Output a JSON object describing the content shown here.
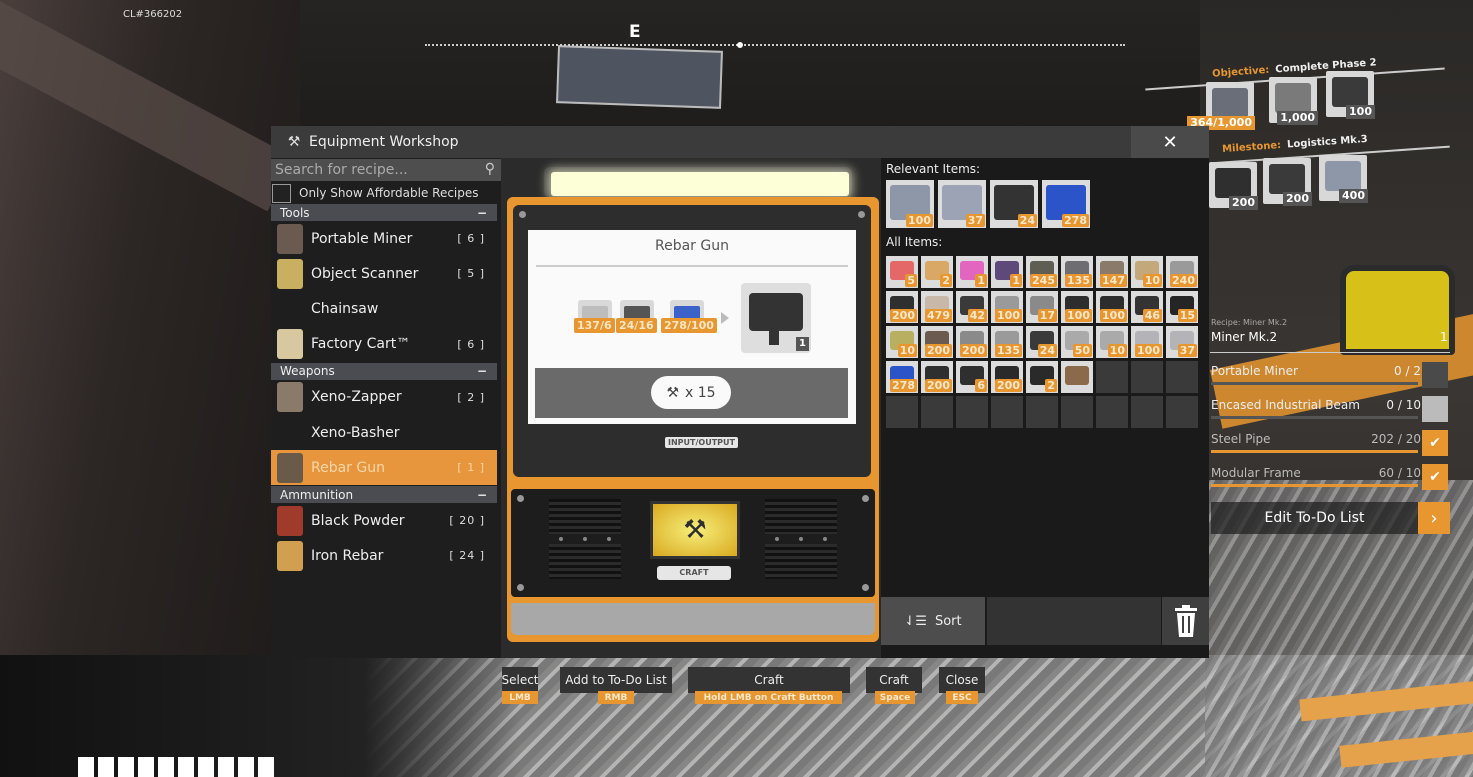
{
  "hud": {
    "build_id": "CL#366202",
    "compass_heading": "E",
    "hotbar_slots": 10
  },
  "window": {
    "title": "Equipment Workshop",
    "title_icon": "hammer-icon",
    "close_icon": "close-icon"
  },
  "recipes": {
    "search_placeholder": "Search for recipe...",
    "affordable_label": "Only Show Affordable Recipes",
    "affordable_checked": false,
    "categories": [
      {
        "name": "Tools",
        "toggle": "−",
        "items": [
          {
            "name": "Portable Miner",
            "count": "[ 6 ]"
          },
          {
            "name": "Object Scanner",
            "count": "[ 5 ]"
          },
          {
            "name": "Chainsaw",
            "count": ""
          },
          {
            "name": "Factory Cart™",
            "count": "[ 6 ]"
          }
        ]
      },
      {
        "name": "Weapons",
        "toggle": "−",
        "items": [
          {
            "name": "Xeno-Zapper",
            "count": "[ 2 ]"
          },
          {
            "name": "Xeno-Basher",
            "count": ""
          },
          {
            "name": "Rebar Gun",
            "count": "[ 1 ]",
            "selected": true
          }
        ]
      },
      {
        "name": "Ammunition",
        "toggle": "−",
        "items": [
          {
            "name": "Black Powder",
            "count": "[ 20 ]"
          },
          {
            "name": "Iron Rebar",
            "count": "[ 24 ]"
          }
        ]
      }
    ]
  },
  "craft": {
    "recipe_name": "Rebar Gun",
    "ingredients": [
      {
        "icon": "reinforced-plate-icon",
        "have_need": "137/6"
      },
      {
        "icon": "iron-rod-icon",
        "have_need": "24/16"
      },
      {
        "icon": "screw-icon",
        "have_need": "278/100"
      }
    ],
    "product": {
      "name": "Rebar Gun",
      "quantity": "1"
    },
    "craft_clicks": "x 15",
    "io_label": "INPUT/OUTPUT",
    "craft_button_label": "CRAFT"
  },
  "inventory": {
    "relevant_label": "Relevant Items:",
    "relevant_items": [
      {
        "icon": "iron-plate-icon",
        "qty": "100",
        "color": "#8e97a8"
      },
      {
        "icon": "reinforced-plate-icon",
        "qty": "37",
        "color": "#9ba3b5"
      },
      {
        "icon": "iron-rod-icon",
        "qty": "24",
        "color": "#333333"
      },
      {
        "icon": "screw-box-icon",
        "qty": "278",
        "color": "#2b54c9"
      }
    ],
    "all_label": "All Items:",
    "all_items": [
      {
        "qty": "5",
        "color": "#e46868"
      },
      {
        "qty": "2",
        "color": "#d9a867"
      },
      {
        "qty": "1",
        "color": "#e266c0"
      },
      {
        "qty": "1",
        "color": "#5e4a7a"
      },
      {
        "qty": "245",
        "color": "#5e5e52"
      },
      {
        "qty": "135",
        "color": "#6e6e72"
      },
      {
        "qty": "147",
        "color": "#8a7a6a"
      },
      {
        "qty": "10",
        "color": "#c2a87a"
      },
      {
        "qty": "240",
        "color": "#9a9a9a"
      },
      {
        "qty": "200",
        "color": "#2f2f2f"
      },
      {
        "qty": "479",
        "color": "#c8b8a8"
      },
      {
        "qty": "42",
        "color": "#3a3a3a"
      },
      {
        "qty": "100",
        "color": "#9a9a9a"
      },
      {
        "qty": "17",
        "color": "#8a8a8a"
      },
      {
        "qty": "100",
        "color": "#2d2d2d"
      },
      {
        "qty": "100",
        "color": "#2d2d2d"
      },
      {
        "qty": "46",
        "color": "#333333"
      },
      {
        "qty": "15",
        "color": "#252525"
      },
      {
        "qty": "10",
        "color": "#b8b060"
      },
      {
        "qty": "200",
        "color": "#6a5a50"
      },
      {
        "qty": "200",
        "color": "#8a8a8a"
      },
      {
        "qty": "135",
        "color": "#9a9a9a"
      },
      {
        "qty": "24",
        "color": "#3a3a3a"
      },
      {
        "qty": "50",
        "color": "#aaaaaa"
      },
      {
        "qty": "10",
        "color": "#aaaaaa"
      },
      {
        "qty": "100",
        "color": "#b4b4b8"
      },
      {
        "qty": "37",
        "color": "#b4b4b8"
      },
      {
        "qty": "278",
        "color": "#2b54c9"
      },
      {
        "qty": "200",
        "color": "#2f2f2f"
      },
      {
        "qty": "6",
        "color": "#2f2f2f"
      },
      {
        "qty": "200",
        "color": "#2a2a2a"
      },
      {
        "qty": "2",
        "color": "#2a2a2a"
      },
      {
        "qty": "",
        "color": "#8a6a4a"
      }
    ],
    "total_slots": 45,
    "sort_label": "Sort",
    "trash_icon": "trash-icon"
  },
  "key_hints": [
    {
      "action": "Select",
      "key": "LMB"
    },
    {
      "action": "Add to To-Do List",
      "key": "RMB"
    },
    {
      "action": "Craft",
      "key": "Hold LMB on Craft Button"
    },
    {
      "action": "Craft",
      "key": "Space"
    },
    {
      "action": "Close",
      "key": "ESC"
    }
  ],
  "objective": {
    "label": "Objective:",
    "value": "Complete Phase 2",
    "items": [
      {
        "qty": "364/1,000",
        "color": "#6a6e78"
      },
      {
        "qty": "1,000",
        "color": "#7a7a7a"
      },
      {
        "qty": "100",
        "color": "#3a3a3a"
      }
    ]
  },
  "milestone": {
    "label": "Milestone:",
    "value": "Logistics Mk.3",
    "items": [
      {
        "qty": "200",
        "color": "#2f2f2f"
      },
      {
        "qty": "200",
        "color": "#3a3a3a"
      },
      {
        "qty": "400",
        "color": "#8e97a8"
      }
    ]
  },
  "todo": {
    "subtitle": "Recipe: Miner Mk.2",
    "title": "Miner Mk.2",
    "quantity": "1",
    "rows": [
      {
        "name": "Portable Miner",
        "progress": "0 / 2",
        "fraction": 0.0,
        "done": false
      },
      {
        "name": "Encased Industrial Beam",
        "progress": "0 / 10",
        "fraction": 0.0,
        "done": false
      },
      {
        "name": "Steel Pipe",
        "progress": "202 / 20",
        "fraction": 1.0,
        "done": true
      },
      {
        "name": "Modular Frame",
        "progress": "60 / 10",
        "fraction": 1.0,
        "done": true
      }
    ],
    "edit_label": "Edit To-Do List"
  }
}
